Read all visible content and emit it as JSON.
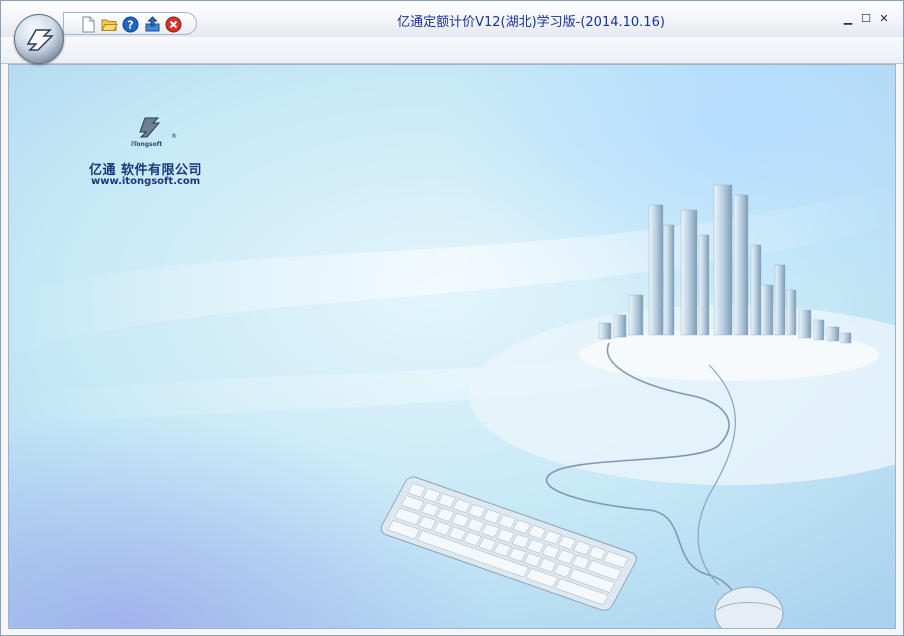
{
  "window": {
    "title": "亿通定额计价V12(湖北)学习版-(2014.10.16)",
    "controls": {
      "minimize": "▁",
      "maximize": "☐",
      "close": "✕"
    }
  },
  "quick_access": [
    {
      "name": "new-document-icon"
    },
    {
      "name": "open-folder-icon"
    },
    {
      "name": "help-icon"
    },
    {
      "name": "export-icon"
    },
    {
      "name": "close-red-icon"
    }
  ],
  "splash": {
    "company_logo_caption": "iTongsoft",
    "company_name": "亿通 软件有限公司",
    "website": "www.itongsoft.com",
    "registered_mark": "®"
  },
  "colors": {
    "title_text": "#1a2fa0",
    "logo_text": "#173a78",
    "close_red": "#d8332a",
    "help_blue": "#1f66c8"
  }
}
